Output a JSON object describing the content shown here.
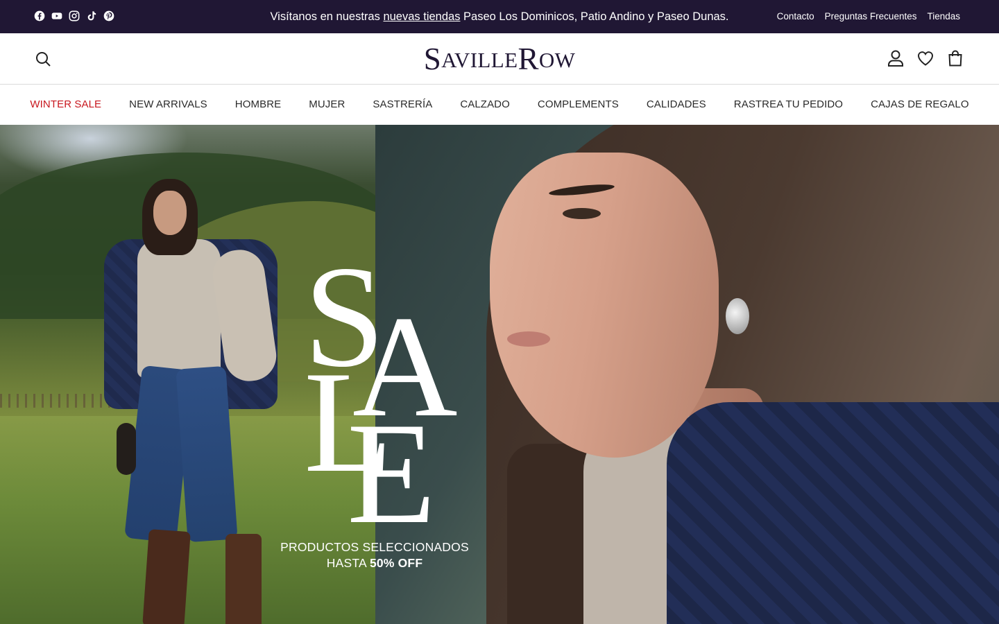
{
  "announcement": {
    "prefix": "Visítanos en nuestras",
    "link_text": "nuevas tiendas",
    "suffix": "Paseo Los Dominicos, Patio Andino y Paseo Dunas."
  },
  "socials": [
    "facebook-icon",
    "youtube-icon",
    "instagram-icon",
    "tiktok-icon",
    "pinterest-icon"
  ],
  "top_links": {
    "contact": "Contacto",
    "faq": "Preguntas Frecuentes",
    "stores": "Tiendas"
  },
  "header": {
    "logo_first_initial": "S",
    "logo_first_rest": "AVILLE",
    "logo_second_initial": "R",
    "logo_second_rest": "OW",
    "icons": [
      "search-icon",
      "account-icon",
      "wishlist-heart-icon",
      "cart-bag-icon"
    ]
  },
  "nav": {
    "items": [
      {
        "label": "WINTER SALE"
      },
      {
        "label": "NEW ARRIVALS"
      },
      {
        "label": "HOMBRE"
      },
      {
        "label": "MUJER"
      },
      {
        "label": "SASTRERÍA"
      },
      {
        "label": "CALZADO"
      },
      {
        "label": "COMPLEMENTS"
      },
      {
        "label": "CALIDADES"
      },
      {
        "label": "RASTREA TU PEDIDO"
      },
      {
        "label": "CAJAS DE REGALO"
      }
    ]
  },
  "hero": {
    "sale_letters": [
      "S",
      "A",
      "L",
      "E"
    ],
    "promo_line1": "PRODUCTOS SELECCIONADOS",
    "promo_line2_prefix": "HASTA",
    "promo_line2_bold": "50% OFF"
  },
  "colors": {
    "topbar_bg": "#201734",
    "logo": "#201734",
    "sale_nav": "#c8171e"
  }
}
